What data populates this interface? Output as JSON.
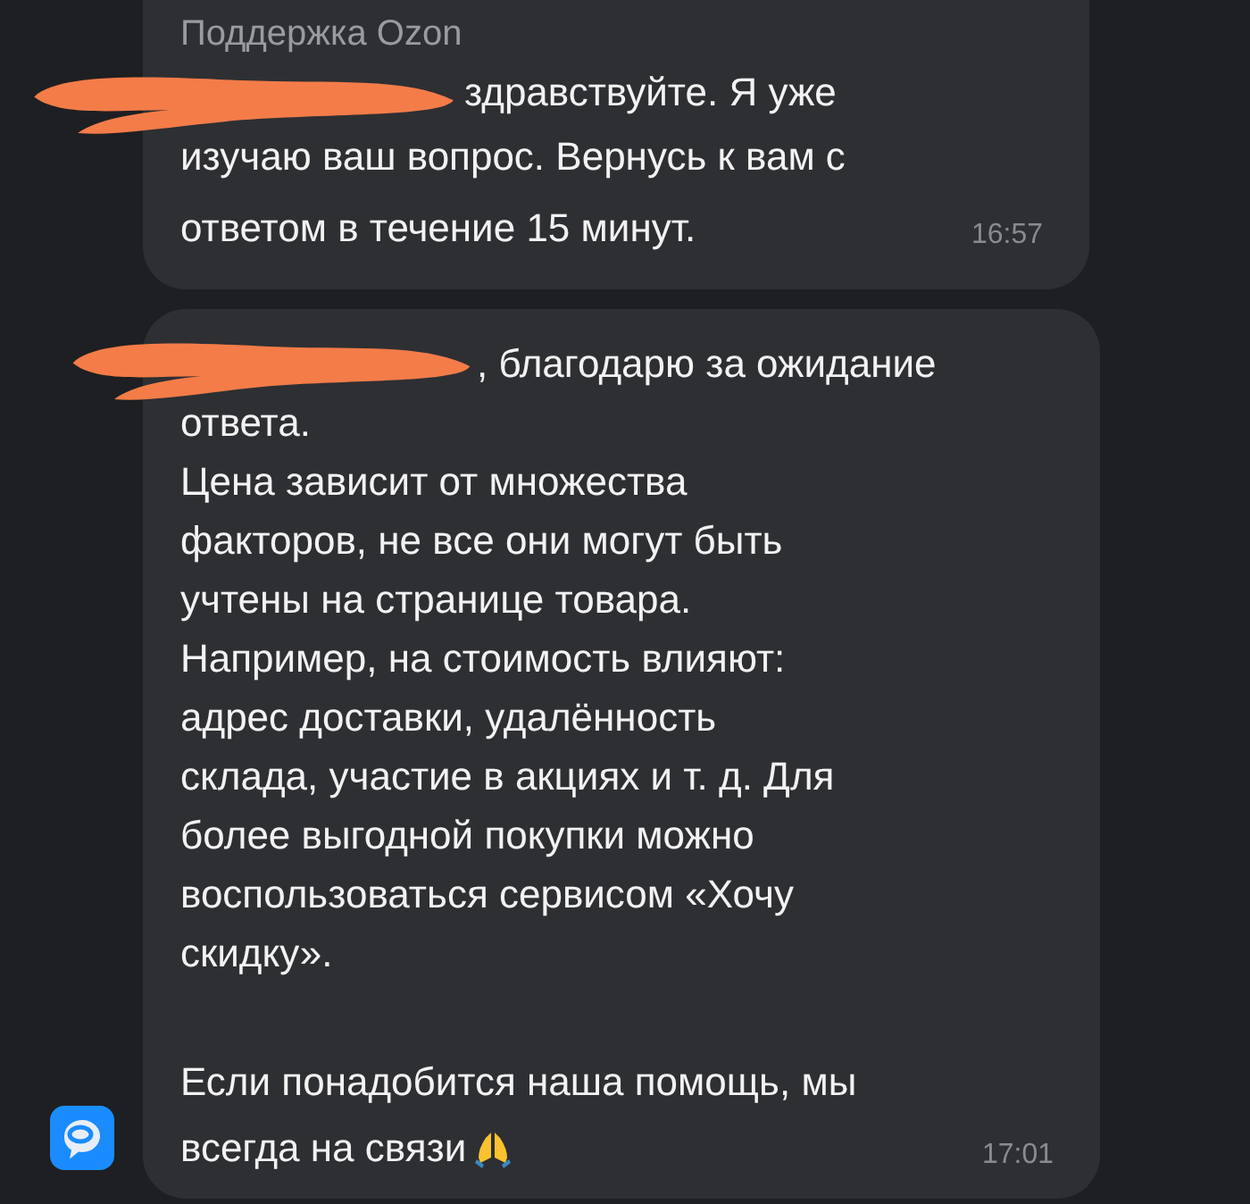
{
  "messages": [
    {
      "sender": "Поддержка Ozon",
      "redacted_start": true,
      "show_avatar": false,
      "paragraphs": [
        {
          "lines": [
            "здравствуйте. Я уже",
            "изучаю ваш вопрос. Вернусь к вам с",
            "ответом в течение 15  минут."
          ]
        }
      ],
      "time": "16:57",
      "emoji_end": false
    },
    {
      "redacted_start": true,
      "show_avatar": true,
      "paragraphs": [
        {
          "lines": [
            ", благодарю за ожидание",
            "ответа.",
            "Цена зависит от множества",
            "факторов, не все они могут быть",
            "учтены на странице товара.",
            "Например, на стоимость влияют:",
            "адрес доставки, удалённость",
            "склада, участие в акциях и т. д. Для",
            "более выгодной покупки можно",
            "воспользоваться сервисом «Хочу",
            "скидку»."
          ]
        },
        {
          "lines": [
            "Если понадобится наша помощь, мы",
            "всегда на связи"
          ]
        }
      ],
      "time": "17:01",
      "emoji_end": true
    }
  ]
}
